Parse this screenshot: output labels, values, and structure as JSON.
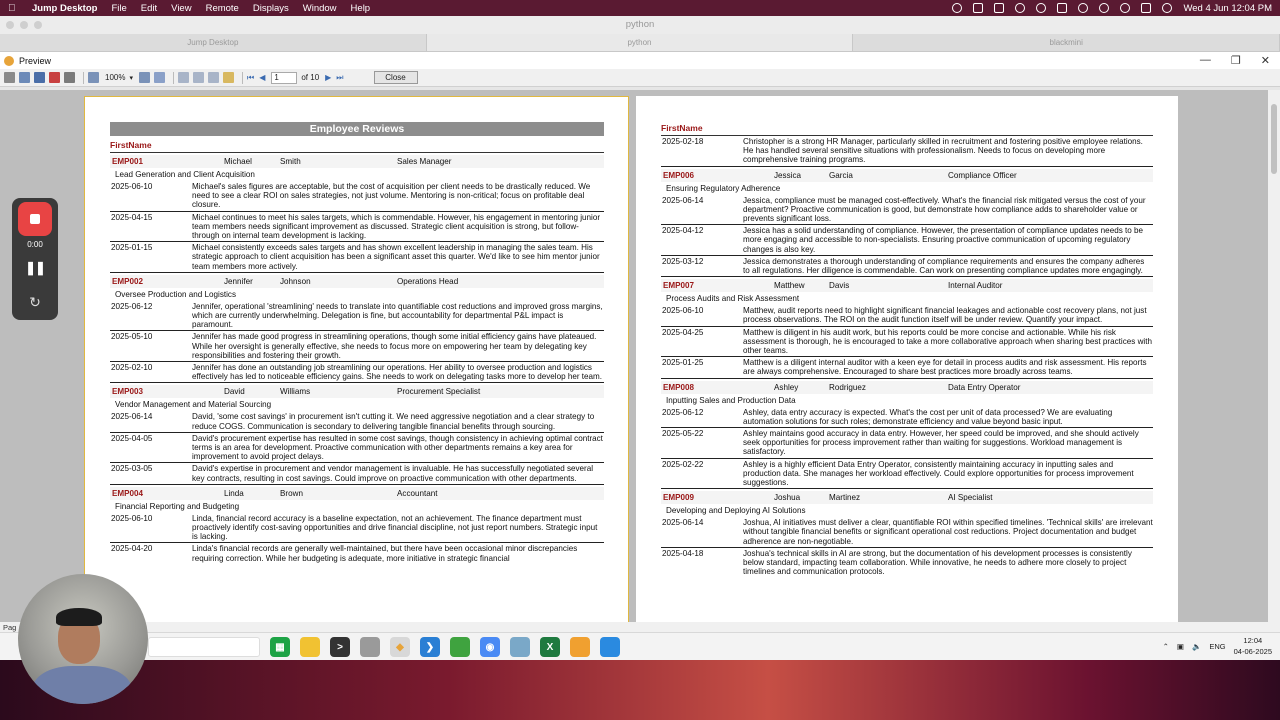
{
  "menubar": {
    "app": "Jump Desktop",
    "items": [
      "File",
      "Edit",
      "View",
      "Remote",
      "Displays",
      "Window",
      "Help"
    ],
    "datetime": "Wed 4 Jun  12:04 PM"
  },
  "jump": {
    "window_title": "python",
    "tabs": [
      "Jump Desktop",
      "python",
      "blackmini"
    ]
  },
  "preview": {
    "title": "Preview",
    "zoom": "100%",
    "page_current": "1",
    "page_total": "of 10",
    "close_label": "Close",
    "status": "Pag"
  },
  "report": {
    "title": "Employee Reviews",
    "header_label": "FirstName",
    "page1": [
      {
        "id": "EMP001",
        "first": "Michael",
        "last": "Smith",
        "title": "Sales Manager",
        "dept": "Lead Generation and Client Acquisition",
        "reviews": [
          {
            "date": "2025-06-10",
            "text": "Michael's sales figures are acceptable, but the cost of acquisition per client needs to be drastically reduced. We need to see a clear ROI on sales strategies, not just volume. Mentoring is non-critical; focus on profitable deal closure."
          },
          {
            "date": "2025-04-15",
            "text": "Michael continues to meet his sales targets, which is commendable. However, his engagement in mentoring junior team members needs significant improvement as discussed. Strategic client acquisition is strong, but follow-through on internal team development is lacking."
          },
          {
            "date": "2025-01-15",
            "text": "Michael consistently exceeds sales targets and has shown excellent leadership in managing the sales team. His strategic approach to client acquisition has been a significant asset this quarter. We'd like to see him mentor junior team members more actively."
          }
        ]
      },
      {
        "id": "EMP002",
        "first": "Jennifer",
        "last": "Johnson",
        "title": "Operations Head",
        "dept": "Oversee Production and Logistics",
        "reviews": [
          {
            "date": "2025-06-12",
            "text": "Jennifer, operational 'streamlining' needs to translate into quantifiable cost reductions and improved gross margins, which are currently underwhelming. Delegation is fine, but accountability for departmental P&L impact is paramount."
          },
          {
            "date": "2025-05-10",
            "text": "Jennifer has made good progress in streamlining operations, though some initial efficiency gains have plateaued. While her oversight is generally effective, she needs to focus more on empowering her team by delegating key responsibilities and fostering their growth."
          },
          {
            "date": "2025-02-10",
            "text": "Jennifer has done an outstanding job streamlining our operations. Her ability to oversee production and logistics effectively has led to noticeable efficiency gains. She needs to work on delegating tasks more to develop her team."
          }
        ]
      },
      {
        "id": "EMP003",
        "first": "David",
        "last": "Williams",
        "title": "Procurement Specialist",
        "dept": "Vendor Management and Material Sourcing",
        "reviews": [
          {
            "date": "2025-06-14",
            "text": "David, 'some cost savings' in procurement isn't cutting it. We need aggressive negotiation and a clear strategy to reduce COGS. Communication is secondary to delivering tangible financial benefits through sourcing."
          },
          {
            "date": "2025-04-05",
            "text": "David's procurement expertise has resulted in some cost savings, though consistency in achieving optimal contract terms is an area for development. Proactive communication with other departments remains a key area for improvement to avoid project delays."
          },
          {
            "date": "2025-03-05",
            "text": "David's expertise in procurement and vendor management is invaluable. He has successfully negotiated several key contracts, resulting in cost savings. Could improve on proactive communication with other departments."
          }
        ]
      },
      {
        "id": "EMP004",
        "first": "Linda",
        "last": "Brown",
        "title": "Accountant",
        "dept": "Financial Reporting and Budgeting",
        "reviews": [
          {
            "date": "2025-06-10",
            "text": "Linda, financial record accuracy is a baseline expectation, not an achievement. The finance department must proactively identify cost-saving opportunities and drive financial discipline, not just report numbers. Strategic input is lacking."
          },
          {
            "date": "2025-04-20",
            "text": "Linda's financial records are generally well-maintained, but there have been occasional minor discrepancies requiring correction. While her budgeting is adequate, more initiative in strategic financial"
          }
        ]
      }
    ],
    "page2_first_review": {
      "date": "2025-02-18",
      "text": "Christopher is a strong HR Manager, particularly skilled in recruitment and fostering positive employee relations. He has handled several sensitive situations with professionalism. Needs to focus on developing more comprehensive training programs."
    },
    "page2": [
      {
        "id": "EMP006",
        "first": "Jessica",
        "last": "Garcia",
        "title": "Compliance Officer",
        "dept": "Ensuring Regulatory Adherence",
        "reviews": [
          {
            "date": "2025-06-14",
            "text": "Jessica, compliance must be managed cost-effectively. What's the financial risk mitigated versus the cost of your department? Proactive communication is good, but demonstrate how compliance adds to shareholder value or prevents significant loss."
          },
          {
            "date": "2025-04-12",
            "text": "Jessica has a solid understanding of compliance. However, the presentation of compliance updates needs to be more engaging and accessible to non-specialists. Ensuring proactive communication of upcoming regulatory changes is also key."
          },
          {
            "date": "2025-03-12",
            "text": "Jessica demonstrates a thorough understanding of compliance requirements and ensures the company adheres to all regulations. Her diligence is commendable. Can work on presenting compliance updates more engagingly."
          }
        ]
      },
      {
        "id": "EMP007",
        "first": "Matthew",
        "last": "Davis",
        "title": "Internal Auditor",
        "dept": "Process Audits and Risk Assessment",
        "reviews": [
          {
            "date": "2025-06-10",
            "text": "Matthew, audit reports need to highlight significant financial leakages and actionable cost recovery plans, not just process observations. The ROI on the audit function itself will be under review. Quantify your impact."
          },
          {
            "date": "2025-04-25",
            "text": "Matthew is diligent in his audit work, but his reports could be more concise and actionable. While his risk assessment is thorough, he is encouraged to take a more collaborative approach when sharing best practices with other teams."
          },
          {
            "date": "2025-01-25",
            "text": "Matthew is a diligent internal auditor with a keen eye for detail in process audits and risk assessment. His reports are always comprehensive. Encouraged to share best practices more broadly across teams."
          }
        ]
      },
      {
        "id": "EMP008",
        "first": "Ashley",
        "last": "Rodriguez",
        "title": "Data Entry Operator",
        "dept": "Inputting Sales and Production Data",
        "reviews": [
          {
            "date": "2025-06-12",
            "text": "Ashley, data entry accuracy is expected. What's the cost per unit of data processed? We are evaluating automation solutions for such roles; demonstrate efficiency and value beyond basic input."
          },
          {
            "date": "2025-05-22",
            "text": "Ashley maintains good accuracy in data entry. However, her speed could be improved, and she should actively seek opportunities for process improvement rather than waiting for suggestions. Workload management is satisfactory."
          },
          {
            "date": "2025-02-22",
            "text": "Ashley is a highly efficient Data Entry Operator, consistently maintaining accuracy in inputting sales and production data. She manages her workload effectively. Could explore opportunities for process improvement suggestions."
          }
        ]
      },
      {
        "id": "EMP009",
        "first": "Joshua",
        "last": "Martinez",
        "title": "AI Specialist",
        "dept": "Developing and Deploying AI Solutions",
        "reviews": [
          {
            "date": "2025-06-14",
            "text": "Joshua, AI initiatives must deliver a clear, quantifiable ROI within specified timelines. 'Technical skills' are irrelevant without tangible financial benefits or significant operational cost reductions. Project documentation and budget adherence are non-negotiable."
          },
          {
            "date": "2025-04-18",
            "text": "Joshua's technical skills in AI are strong, but the documentation of his development processes is consistently below standard, impacting team collaboration. While innovative, he needs to adhere more closely to project timelines and communication protocols."
          }
        ]
      }
    ]
  },
  "recorder": {
    "time": "0:00"
  },
  "taskbar": {
    "lang": "ENG",
    "time": "12:04",
    "date": "04-06-2025"
  }
}
